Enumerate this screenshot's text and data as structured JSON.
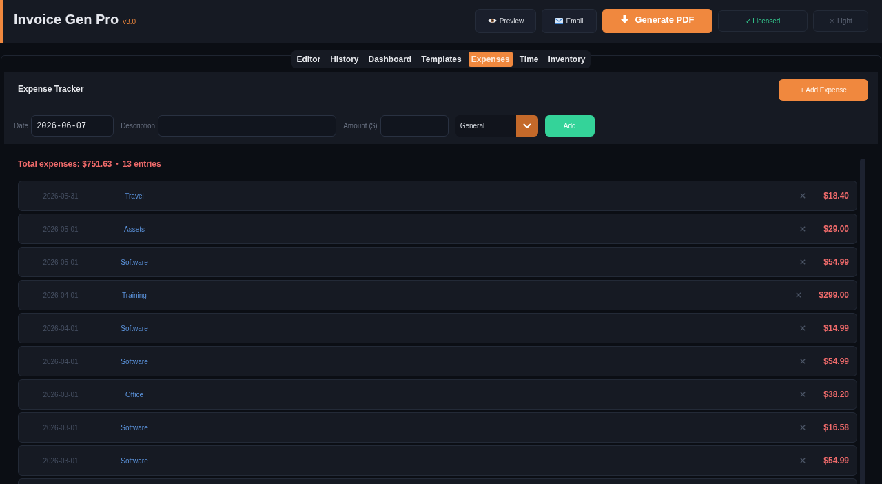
{
  "header": {
    "title": "Invoice Gen Pro",
    "version": "v3.0",
    "buttons": [
      {
        "kind": "preview",
        "label": "Preview"
      },
      {
        "kind": "email",
        "label": "Email"
      },
      {
        "kind": "generate",
        "label": "Generate PDF"
      },
      {
        "kind": "license",
        "label": "✓ Licensed"
      },
      {
        "kind": "theme",
        "label": "☀ Light"
      }
    ]
  },
  "tabs": [
    {
      "label": "Editor",
      "selected": false
    },
    {
      "label": "History",
      "selected": false
    },
    {
      "label": "Dashboard",
      "selected": false
    },
    {
      "label": "Templates",
      "selected": false
    },
    {
      "label": "Expenses",
      "selected": true
    },
    {
      "label": "Time",
      "selected": false
    },
    {
      "label": "Inventory",
      "selected": false
    }
  ],
  "expense_tracker": {
    "title": "Expense Tracker",
    "add_button": "+ Add Expense",
    "form": {
      "date": {
        "label": "Date",
        "value": "2026-06-07"
      },
      "description": {
        "label": "Description"
      },
      "amount": {
        "label": "Amount ($)"
      },
      "category": {
        "value": "General"
      },
      "submit": "Add"
    }
  },
  "summary": {
    "total": "Total expenses: $751.63",
    "separator": "•",
    "count": "13 entries"
  },
  "expenses": [
    {
      "kind": "entry",
      "date": "2026-05-31",
      "category": "Travel",
      "amount": "$18.40"
    },
    {
      "kind": "entry",
      "date": "2026-05-01",
      "category": "Assets",
      "amount": "$29.00"
    },
    {
      "kind": "entry",
      "date": "2026-05-01",
      "category": "Software",
      "amount": "$54.99"
    },
    {
      "kind": "entry",
      "date": "2026-04-01",
      "category": "Training",
      "amount": "$299.00"
    },
    {
      "kind": "entry",
      "date": "2026-04-01",
      "category": "Software",
      "amount": "$14.99"
    },
    {
      "kind": "entry",
      "date": "2026-04-01",
      "category": "Software",
      "amount": "$54.99"
    },
    {
      "kind": "entry",
      "date": "2026-03-01",
      "category": "Office",
      "amount": "$38.20"
    },
    {
      "kind": "entry",
      "date": "2026-03-01",
      "category": "Software",
      "amount": "$16.58"
    },
    {
      "kind": "entry",
      "date": "2026-03-01",
      "category": "Software",
      "amount": "$54.99"
    },
    {
      "kind": "clipped"
    }
  ]
}
